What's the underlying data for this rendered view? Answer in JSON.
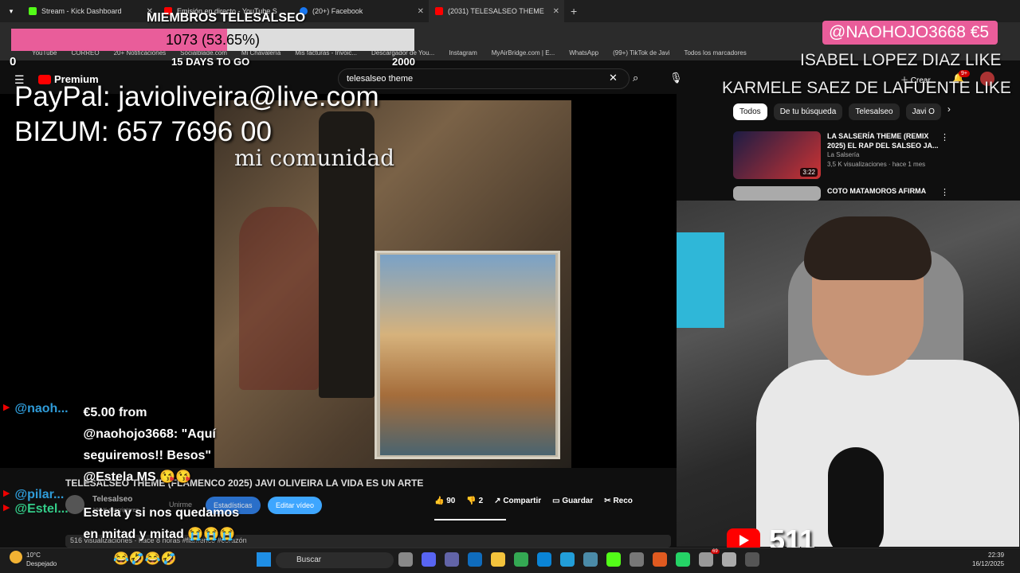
{
  "browser": {
    "tabs": [
      {
        "label": "Stream - Kick Dashboard",
        "color": "#53fc18"
      },
      {
        "label": "Emisión en directo - YouTube S",
        "color": "#f00"
      },
      {
        "label": "(20+) Facebook",
        "color": "#1877f2"
      },
      {
        "label": "(2031) TELESALSEO THEME",
        "color": "#f00"
      }
    ],
    "bookmarks": [
      "YouTube",
      "CORREO",
      "20+ Notificaciones",
      "Socialblade.com",
      "Mi Chavalería",
      "Mis facturas - Invoic...",
      "Descargador de You...",
      "Instagram",
      "MyAirBridge.com | E...",
      "WhatsApp",
      "(99+) TikTok de Javi",
      "Todos los marcadores"
    ]
  },
  "overlay": {
    "miembros": "MIEMBROS TELESALSEO",
    "progress_label": "1073 (53.65%)",
    "progress_fraction": 0.5365,
    "min": "0",
    "max": "2000",
    "days_to_go": "15 DAYS TO GO",
    "paypal": "PayPal: javioliveira@live.com",
    "bizum": "BIZUM: 657 7696 00",
    "donation_badge": "@NAOHOJO3668  €5",
    "like1": "ISABEL LOPEZ DIAZ  LIKE",
    "like2": "KARMELE SAEZ DE LAFUENTE  LIKE",
    "video_caption": "mi comunidad",
    "viewer_count": "511"
  },
  "yt": {
    "logo": "Premium",
    "search_value": "telesalseo theme",
    "create": "Crear",
    "notif_badge": "9+",
    "chips": [
      "Todos",
      "De tu búsqueda",
      "Telesalseo",
      "Javi O"
    ],
    "recs": [
      {
        "title": "LA SALSERÍA THEME (REMIX 2025) EL RAP DEL SALSEO JA...",
        "channel": "La Salsería",
        "meta": "3,5 K visualizaciones · hace 1 mes",
        "duration": "3:22"
      },
      {
        "title": "COTO MATAMOROS AFIRMA",
        "channel": "",
        "meta": "",
        "duration": ""
      }
    ],
    "video_title": "TELESALSEO THEME (FLAMENCO 2025) JAVI OLIVEIRA LA VIDA ES UN ARTE",
    "channel": "Telesalseo",
    "subs": "192 K suscriptores",
    "unsubscribe": "Unirme",
    "stats": "Estadísticas",
    "edit": "Editar vídeo",
    "likes": "90",
    "dislikes": "2",
    "share": "Compartir",
    "save": "Guardar",
    "clip": "Reco",
    "views_line": "516 visualizaciones · hace 8 horas #flamenco #corazón"
  },
  "chat": [
    {
      "name": "@naoh...",
      "msg": "€5.00 from @naohojo3668: \"Aquí seguiremos!! Besos\" @Estela MS 😘😘"
    },
    {
      "name": "@pilar...",
      "msg": ""
    },
    {
      "name": "@Estel...",
      "msg": "Estela y si nos quedamos en mitad y mitad 😭😭😭 👑👑👑"
    }
  ],
  "taskbar": {
    "weather_temp": "10°C",
    "weather_desc": "Despejado",
    "search": "Buscar",
    "time": "22:39",
    "date": "16/12/2025",
    "notif": "69"
  }
}
